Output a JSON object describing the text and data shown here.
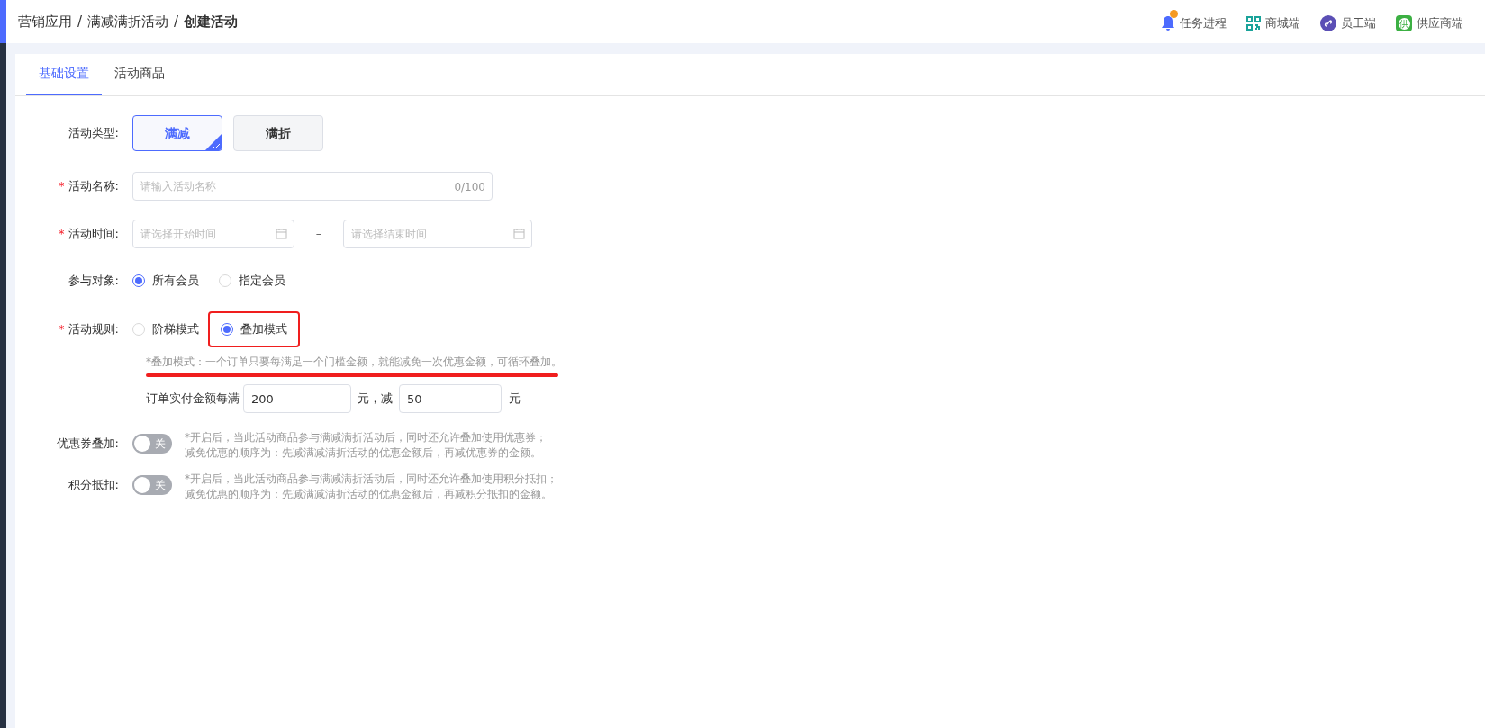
{
  "breadcrumb": {
    "separator": "/",
    "items": [
      "营销应用",
      "满减满折活动",
      "创建活动"
    ]
  },
  "header_links": [
    {
      "kind": "bell",
      "label": "任务进程",
      "badge": true
    },
    {
      "kind": "qr",
      "label": "商城端",
      "badge": false
    },
    {
      "kind": "link",
      "label": "员工端",
      "badge": false
    },
    {
      "kind": "supplier",
      "label": "供应商端",
      "badge": false
    }
  ],
  "supplier_icon_text": "供",
  "tabs": [
    {
      "label": "基础设置",
      "selected": true
    },
    {
      "label": "活动商品",
      "selected": false
    }
  ],
  "form": {
    "required_mark": "*",
    "activity_type": {
      "label": "活动类型:",
      "options": [
        {
          "label": "满减",
          "selected": true
        },
        {
          "label": "满折",
          "selected": false
        }
      ]
    },
    "name": {
      "label": "活动名称:",
      "required": true,
      "placeholder": "请输入活动名称",
      "counter": "0/100"
    },
    "time": {
      "label": "活动时间:",
      "required": true,
      "start_placeholder": "请选择开始时间",
      "separator": "–",
      "end_placeholder": "请选择结束时间"
    },
    "audience": {
      "label": "参与对象:",
      "required": false,
      "options": [
        {
          "label": "所有会员",
          "selected": true,
          "highlighted": false
        },
        {
          "label": "指定会员",
          "selected": false,
          "highlighted": false
        }
      ]
    },
    "rule": {
      "label": "活动规则:",
      "required": true,
      "options": [
        {
          "label": "阶梯模式",
          "selected": false,
          "highlighted": false
        },
        {
          "label": "叠加模式",
          "selected": true,
          "highlighted": true
        }
      ],
      "hint": "*叠加模式：一个订单只要每满足一个门槛金额，就能减免一次优惠金额，可循环叠加。",
      "hint_underlined": true,
      "amount": {
        "prefix": "订单实付金额每满",
        "threshold": "200",
        "middle": "元，减",
        "discount": "50",
        "suffix": "元"
      }
    },
    "toggles": [
      {
        "label": "优惠券叠加:",
        "on": false,
        "text": "关",
        "note": [
          "*开启后，当此活动商品参与满减满折活动后，同时还允许叠加使用优惠券；",
          "减免优惠的顺序为：先减满减满折活动的优惠金额后，再减优惠券的金额。"
        ]
      },
      {
        "label": "积分抵扣:",
        "on": false,
        "text": "关",
        "note": [
          "*开启后，当此活动商品参与满减满折活动后，同时还允许叠加使用积分抵扣；",
          "减免优惠的顺序为：先减满减满折活动的优惠金额后，再减积分抵扣的金额。"
        ]
      }
    ]
  }
}
